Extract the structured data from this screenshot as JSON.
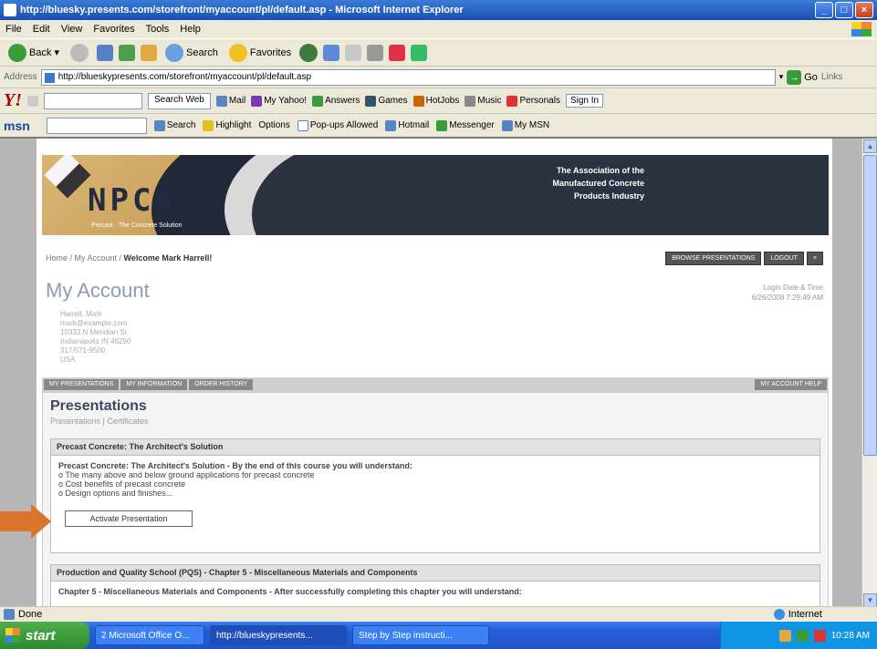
{
  "window": {
    "title": "http://bluesky.presents.com/storefront/myaccount/pl/default.asp - Microsoft Internet Explorer"
  },
  "menu": [
    "File",
    "Edit",
    "View",
    "Favorites",
    "Tools",
    "Help"
  ],
  "toolbar": {
    "back": "Back",
    "search": "Search",
    "favorites": "Favorites"
  },
  "address": {
    "label": "Address",
    "url": "http://blueskypresents.com/storefront/myaccount/pl/default.asp",
    "go": "Go",
    "links": "Links"
  },
  "yahoo": {
    "logo": "Y!",
    "search_web": "Search Web",
    "mail": "Mail",
    "my_yahoo": "My Yahoo!",
    "answers": "Answers",
    "games": "Games",
    "hotjobs": "HotJobs",
    "music": "Music",
    "personals": "Personals",
    "signin": "Sign In"
  },
  "msn": {
    "logo": "msn",
    "search": "Search",
    "highlight": "Highlight",
    "options": "Options",
    "popups": "Pop-ups Allowed",
    "hotmail": "Hotmail",
    "messenger": "Messenger",
    "mymsn": "My MSN"
  },
  "banner": {
    "logo": "NPCA",
    "tagline": "Precast · The Concrete Solution",
    "association": "The Association of the Manufactured Concrete Products Industry"
  },
  "page": {
    "breadcrumb_prefix": "Home / My Account /",
    "breadcrumb_current": "Welcome Mark Harrell!",
    "btn_browse": "BROWSE PRESENTATIONS",
    "btn_logout": "LOGOUT",
    "title": "My Account",
    "login_label": "Login Date & Time",
    "login_value": "6/26/2008 7:29:49 AM",
    "address_lines": [
      "Harrell, Mark",
      "mark@example.com",
      "10333 N Meridian St",
      "Indianapolis IN 46290",
      "317/571-9500",
      "USA"
    ],
    "tabs": [
      "MY PRESENTATIONS",
      "MY INFORMATION",
      "ORDER HISTORY"
    ],
    "tab_right": "MY ACCOUNT HELP",
    "section_title": "Presentations",
    "section_sub": "Presentations | Certificates",
    "card1": {
      "head": "Precast Concrete: The Architect's Solution",
      "lead": "Precast Concrete: The Architect's Solution - By the end of this course you will understand:",
      "lines": [
        "o The many above and below ground applications for precast concrete",
        "o Cost benefits of precast concrete",
        "o Design options and finishes..."
      ],
      "button": "Activate Presentation"
    },
    "card2": {
      "head": "Production and Quality School (PQS) - Chapter 5 - Miscellaneous Materials and Components",
      "body": "Chapter 5 - Miscellaneous Materials and Components - After successfully completing this chapter you will understand:"
    }
  },
  "status": {
    "left": "Done",
    "zone": "Internet"
  },
  "taskbar": {
    "start": "start",
    "items": [
      "2 Microsoft Office O...",
      "http://blueskypresents...",
      "Step by Step instructi..."
    ],
    "time": "10:28 AM"
  },
  "colors": {
    "arrow": "#d9742a",
    "banner_dark": "#2d3240",
    "banner_gold": "#c99c50",
    "title": "#909bb2"
  }
}
